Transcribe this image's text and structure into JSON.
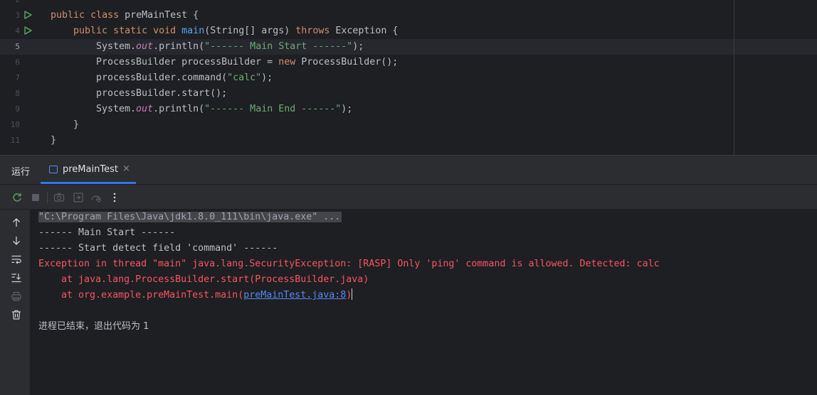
{
  "editor": {
    "line_numbers": [
      "2",
      "3",
      "4",
      "5",
      "6",
      "7",
      "8",
      "9",
      "10",
      "11"
    ],
    "current_line": "5",
    "code": {
      "l3": {
        "kw1": "public",
        "kw2": "class",
        "rest": " preMainTest {"
      },
      "l4": {
        "kw1": "public",
        "kw2": "static",
        "kw3": "void",
        "fn": "main",
        "args": "(String[] args) ",
        "kw4": "throws",
        "rest": " Exception {"
      },
      "l5": {
        "pre": "System.",
        "fld": "out",
        "mid": ".println(",
        "str": "\"------ Main Start ------\"",
        "post": ");"
      },
      "l6": {
        "pre": "ProcessBuilder processBuilder = ",
        "kw": "new",
        "post": " ProcessBuilder();"
      },
      "l7": {
        "pre": "processBuilder.command(",
        "str": "\"calc\"",
        "post": ");"
      },
      "l8": {
        "text": "processBuilder.start();"
      },
      "l9": {
        "pre": "System.",
        "fld": "out",
        "mid": ".println(",
        "str": "\"------ Main End ------\"",
        "post": ");"
      },
      "l10": {
        "text": "}"
      },
      "l11": {
        "text": "}"
      }
    }
  },
  "panel": {
    "title": "运行",
    "tab_label": "preMainTest",
    "tab_close": "×"
  },
  "console": {
    "cmd": "\"C:\\Program Files\\Java\\jdk1.8.0_111\\bin\\java.exe\" ...",
    "out1": "------ Main Start ------",
    "out2": "------ Start detect field 'command' ------",
    "err1": "Exception in thread \"main\" java.lang.SecurityException: [RASP] Only 'ping' command is allowed. Detected: calc",
    "err2": "    at java.lang.ProcessBuilder.start(ProcessBuilder.java)",
    "err3_pre": "    at org.example.preMainTest.main(",
    "err3_link": "preMainTest.java:8",
    "err3_post": ")",
    "exit": "进程已结束，退出代码为 1"
  },
  "colors": {
    "keyword": "#cf8e6d",
    "function": "#56a8f5",
    "string": "#6aab73",
    "field": "#c77dbb",
    "error": "#f75464",
    "link": "#548af7",
    "accent": "#3574f0"
  },
  "icons": {
    "gutter": [
      "run-class-icon",
      "run-main-icon"
    ],
    "toolbar": [
      "rerun-icon",
      "stop-icon",
      "camera-icon",
      "restore-layout-icon",
      "profiler-icon",
      "more-options-icon"
    ],
    "side": [
      "up-arrow-icon",
      "down-arrow-icon",
      "soft-wrap-icon",
      "scroll-to-end-icon",
      "print-icon",
      "trash-icon"
    ]
  }
}
